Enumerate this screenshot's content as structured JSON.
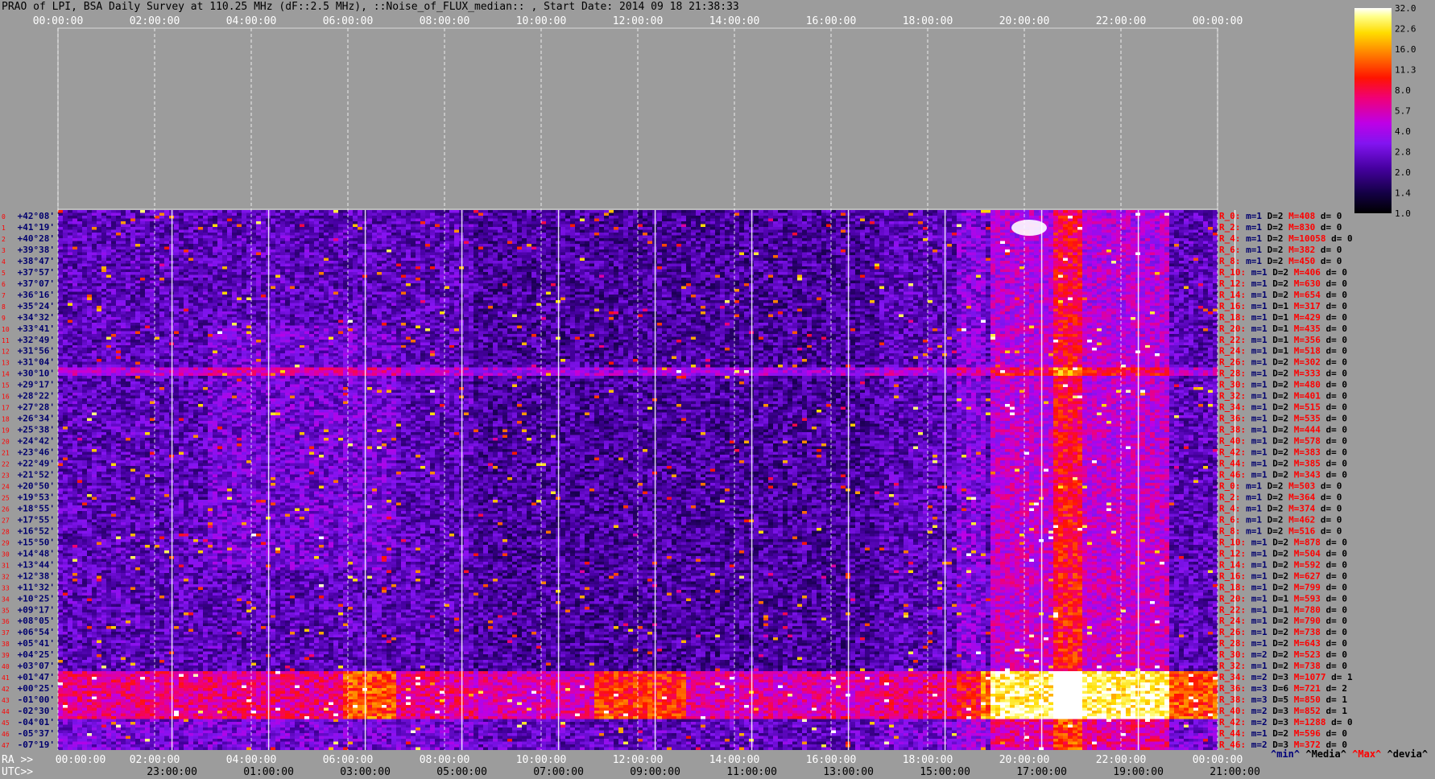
{
  "header": {
    "title": "PRAO of LPI, BSA Daily Survey at 110.25 MHz (dF::2.5 MHz), ::Noise_of_FLUX_median:: , Start Date: 2014 09 18 21:38:33"
  },
  "colorbar": {
    "ticks": [
      "32.0",
      "22.6",
      "16.0",
      "11.3",
      "8.0",
      "5.7",
      "4.0",
      "2.8",
      "2.0",
      "1.4",
      "1.0"
    ]
  },
  "footer": {
    "ra_prefix": "RA >>",
    "utc_prefix": "UTC>>",
    "legend": [
      {
        "label": "^min^",
        "color": "#00007a"
      },
      {
        "label": "^Media^",
        "color": "#000000"
      },
      {
        "label": "^Max^",
        "color": "#ff0000"
      },
      {
        "label": "^devia^",
        "color": "#000000"
      }
    ]
  },
  "colors": {
    "background": "#9c9c9c",
    "row_index": "#ff0000",
    "row_label": "#00006e"
  },
  "chart_data": {
    "type": "heatmap",
    "x_ra_ticks": [
      "00:00:00",
      "02:00:00",
      "04:00:00",
      "06:00:00",
      "08:00:00",
      "10:00:00",
      "12:00:00",
      "14:00:00",
      "16:00:00",
      "18:00:00",
      "20:00:00",
      "22:00:00",
      "00:00:00"
    ],
    "x_utc_ticks": [
      "23:00:00",
      "01:00:00",
      "03:00:00",
      "05:00:00",
      "07:00:00",
      "09:00:00",
      "11:00:00",
      "13:00:00",
      "15:00:00",
      "17:00:00",
      "19:00:00",
      "21:00:00"
    ],
    "colorscale": [
      1.0,
      32.0
    ],
    "dec_labels": [
      "+42°08'",
      "+41°19'",
      "+40°28'",
      "+39°38'",
      "+38°47'",
      "+37°57'",
      "+37°07'",
      "+36°16'",
      "+35°24'",
      "+34°32'",
      "+33°41'",
      "+32°49'",
      "+31°56'",
      "+31°04'",
      "+30°10'",
      "+29°17'",
      "+28°22'",
      "+27°28'",
      "+26°34'",
      "+25°38'",
      "+24°42'",
      "+23°46'",
      "+22°49'",
      "+21°52'",
      "+20°50'",
      "+19°53'",
      "+18°55'",
      "+17°55'",
      "+16°52'",
      "+15°50'",
      "+14°48'",
      "+13°44'",
      "+12°38'",
      "+11°32'",
      "+10°25'",
      "+09°17'",
      "+08°05'",
      "+06°54'",
      "+05°41'",
      "+04°25'",
      "+03°07'",
      "+01°47'",
      "+00°25'",
      "-01°00'",
      "-02°30'",
      "-04°01'",
      "-05°37'",
      "-07°19'"
    ],
    "row_stats": [
      {
        "r": "R_0:",
        "m": "m=1",
        "d": "D=2",
        "M": "M=408",
        "dev": "d= 0"
      },
      {
        "r": "R_2:",
        "m": "m=1",
        "d": "D=2",
        "M": "M=830",
        "dev": "d= 0"
      },
      {
        "r": "R_4:",
        "m": "m=1",
        "d": "D=2",
        "M": "M=10058",
        "dev": "d= 0"
      },
      {
        "r": "R_6:",
        "m": "m=1",
        "d": "D=2",
        "M": "M=382",
        "dev": "d= 0"
      },
      {
        "r": "R_8:",
        "m": "m=1",
        "d": "D=2",
        "M": "M=450",
        "dev": "d= 0"
      },
      {
        "r": "R_10:",
        "m": "m=1",
        "d": "D=2",
        "M": "M=406",
        "dev": "d= 0"
      },
      {
        "r": "R_12:",
        "m": "m=1",
        "d": "D=2",
        "M": "M=630",
        "dev": "d= 0"
      },
      {
        "r": "R_14:",
        "m": "m=1",
        "d": "D=2",
        "M": "M=654",
        "dev": "d= 0"
      },
      {
        "r": "R_16:",
        "m": "m=1",
        "d": "D=1",
        "M": "M=317",
        "dev": "d= 0"
      },
      {
        "r": "R_18:",
        "m": "m=1",
        "d": "D=1",
        "M": "M=429",
        "dev": "d= 0"
      },
      {
        "r": "R_20:",
        "m": "m=1",
        "d": "D=1",
        "M": "M=435",
        "dev": "d= 0"
      },
      {
        "r": "R_22:",
        "m": "m=1",
        "d": "D=1",
        "M": "M=356",
        "dev": "d= 0"
      },
      {
        "r": "R_24:",
        "m": "m=1",
        "d": "D=1",
        "M": "M=518",
        "dev": "d= 0"
      },
      {
        "r": "R_26:",
        "m": "m=1",
        "d": "D=2",
        "M": "M=302",
        "dev": "d= 0"
      },
      {
        "r": "R_28:",
        "m": "m=1",
        "d": "D=2",
        "M": "M=333",
        "dev": "d= 0"
      },
      {
        "r": "R_30:",
        "m": "m=1",
        "d": "D=2",
        "M": "M=480",
        "dev": "d= 0"
      },
      {
        "r": "R_32:",
        "m": "m=1",
        "d": "D=2",
        "M": "M=401",
        "dev": "d= 0"
      },
      {
        "r": "R_34:",
        "m": "m=1",
        "d": "D=2",
        "M": "M=515",
        "dev": "d= 0"
      },
      {
        "r": "R_36:",
        "m": "m=1",
        "d": "D=2",
        "M": "M=535",
        "dev": "d= 0"
      },
      {
        "r": "R_38:",
        "m": "m=1",
        "d": "D=2",
        "M": "M=444",
        "dev": "d= 0"
      },
      {
        "r": "R_40:",
        "m": "m=1",
        "d": "D=2",
        "M": "M=578",
        "dev": "d= 0"
      },
      {
        "r": "R_42:",
        "m": "m=1",
        "d": "D=2",
        "M": "M=383",
        "dev": "d= 0"
      },
      {
        "r": "R_44:",
        "m": "m=1",
        "d": "D=2",
        "M": "M=385",
        "dev": "d= 0"
      },
      {
        "r": "R_46:",
        "m": "m=1",
        "d": "D=2",
        "M": "M=343",
        "dev": "d= 0"
      },
      {
        "r": "R_0:",
        "m": "m=1",
        "d": "D=2",
        "M": "M=503",
        "dev": "d= 0"
      },
      {
        "r": "R_2:",
        "m": "m=1",
        "d": "D=2",
        "M": "M=364",
        "dev": "d= 0"
      },
      {
        "r": "R_4:",
        "m": "m=1",
        "d": "D=2",
        "M": "M=374",
        "dev": "d= 0"
      },
      {
        "r": "R_6:",
        "m": "m=1",
        "d": "D=2",
        "M": "M=462",
        "dev": "d= 0"
      },
      {
        "r": "R_8:",
        "m": "m=1",
        "d": "D=2",
        "M": "M=516",
        "dev": "d= 0"
      },
      {
        "r": "R_10:",
        "m": "m=1",
        "d": "D=2",
        "M": "M=878",
        "dev": "d= 0"
      },
      {
        "r": "R_12:",
        "m": "m=1",
        "d": "D=2",
        "M": "M=504",
        "dev": "d= 0"
      },
      {
        "r": "R_14:",
        "m": "m=1",
        "d": "D=2",
        "M": "M=592",
        "dev": "d= 0"
      },
      {
        "r": "R_16:",
        "m": "m=1",
        "d": "D=2",
        "M": "M=627",
        "dev": "d= 0"
      },
      {
        "r": "R_18:",
        "m": "m=1",
        "d": "D=2",
        "M": "M=799",
        "dev": "d= 0"
      },
      {
        "r": "R_20:",
        "m": "m=1",
        "d": "D=1",
        "M": "M=593",
        "dev": "d= 0"
      },
      {
        "r": "R_22:",
        "m": "m=1",
        "d": "D=1",
        "M": "M=780",
        "dev": "d= 0"
      },
      {
        "r": "R_24:",
        "m": "m=1",
        "d": "D=2",
        "M": "M=790",
        "dev": "d= 0"
      },
      {
        "r": "R_26:",
        "m": "m=1",
        "d": "D=2",
        "M": "M=738",
        "dev": "d= 0"
      },
      {
        "r": "R_28:",
        "m": "m=1",
        "d": "D=2",
        "M": "M=643",
        "dev": "d= 0"
      },
      {
        "r": "R_30:",
        "m": "m=2",
        "d": "D=2",
        "M": "M=523",
        "dev": "d= 0"
      },
      {
        "r": "R_32:",
        "m": "m=1",
        "d": "D=2",
        "M": "M=738",
        "dev": "d= 0"
      },
      {
        "r": "R_34:",
        "m": "m=2",
        "d": "D=3",
        "M": "M=1077",
        "dev": "d= 1"
      },
      {
        "r": "R_36:",
        "m": "m=3",
        "d": "D=6",
        "M": "M=721",
        "dev": "d= 2"
      },
      {
        "r": "R_38:",
        "m": "m=3",
        "d": "D=5",
        "M": "M=850",
        "dev": "d= 1"
      },
      {
        "r": "R_40:",
        "m": "m=2",
        "d": "D=3",
        "M": "M=852",
        "dev": "d= 1"
      },
      {
        "r": "R_42:",
        "m": "m=2",
        "d": "D=3",
        "M": "M=1288",
        "dev": "d= 0"
      },
      {
        "r": "R_44:",
        "m": "m=1",
        "d": "D=2",
        "M": "M=596",
        "dev": "d= 0"
      },
      {
        "r": "R_46:",
        "m": "m=2",
        "d": "D=3",
        "M": "M=372",
        "dev": "d= 0"
      }
    ]
  }
}
